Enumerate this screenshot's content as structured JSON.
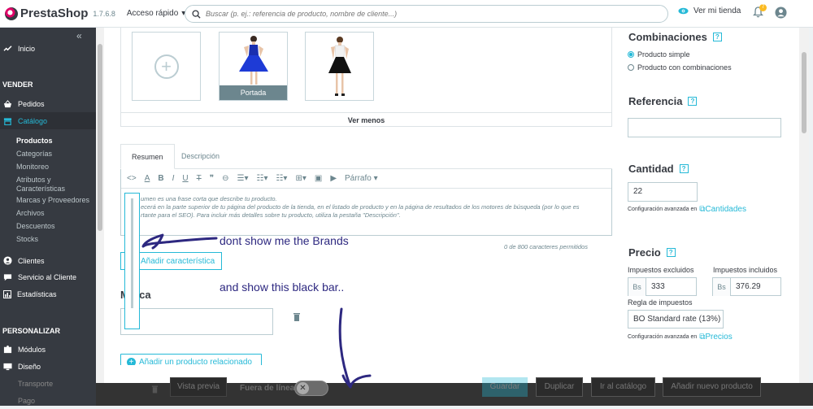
{
  "topbar": {
    "logo": "PrestaShop",
    "version": "1.7.6.8",
    "quick_access": "Acceso rápido",
    "search_placeholder": "Buscar (p. ej.: referencia de producto, nombre de cliente...)",
    "view_store": "Ver mi tienda",
    "notifications_count": "7"
  },
  "sidebar": {
    "inicio": "Inicio",
    "section_vender": "VENDER",
    "pedidos": "Pedidos",
    "catalogo": "Catálogo",
    "sub": [
      "Productos",
      "Categorías",
      "Monitoreo",
      "Atributos y Características",
      "Marcas y Proveedores",
      "Archivos",
      "Descuentos",
      "Stocks"
    ],
    "clientes": "Clientes",
    "servicio": "Servicio al Cliente",
    "estadisticas": "Estadísticas",
    "section_personalizar": "PERSONALIZAR",
    "modulos": "Módulos",
    "diseno": "Diseño",
    "transporte": "Transporte",
    "pago": "Pago"
  },
  "images": {
    "cover_label": "Portada",
    "see_less": "Ver menos"
  },
  "tabs": {
    "summary": "Resumen",
    "description": "Descripción"
  },
  "editor": {
    "paragraph": "Párrafo",
    "text_line1": "umen es una frase corta que describe tu producto.",
    "text_line2": "ecerá en la parte superior de tu página del producto de la tienda, en el listado de producto y en la página de resultados de los motores de búsqueda (por lo que es",
    "text_line3": "rtante para el SEO). Para incluir más detalles sobre tu producto, utiliza la pestaña \"Descripción\".",
    "char_count": "0 de 800 caracteres permitidos"
  },
  "main": {
    "add_feature": "Añadir característica",
    "brand_title": "Marca",
    "add_related": "Añadir un producto relacionado"
  },
  "right": {
    "combinations_title": "Combinaciones",
    "simple_product": "Producto simple",
    "with_combinations": "Producto con combinaciones",
    "reference_title": "Referencia",
    "quantity_title": "Cantidad",
    "quantity_value": "22",
    "advanced_config": "Configuración avanzada en",
    "quantities_link": "Cantidades",
    "price_title": "Precio",
    "tax_excl_label": "Impuestos excluidos",
    "tax_incl_label": "Impuestos incluidos",
    "currency": "Bs",
    "price_excl": "333",
    "price_incl": "376.29",
    "tax_rule_label": "Regla de impuestos",
    "tax_rule_value": "BO Standard rate (13%)",
    "prices_link": "Precios"
  },
  "footer": {
    "preview": "Vista previa",
    "offline": "Fuera de línea",
    "save": "Guardar",
    "duplicate": "Duplicar",
    "go_catalog": "Ir al catálogo",
    "add_new": "Añadir nuevo producto"
  },
  "annotations": {
    "note1": "dont show me the Brands",
    "note2": "and show this black bar.."
  },
  "colors": {
    "accent": "#25b9d7",
    "sidebar": "#363a41",
    "annotation_ink": "#2d2880"
  }
}
